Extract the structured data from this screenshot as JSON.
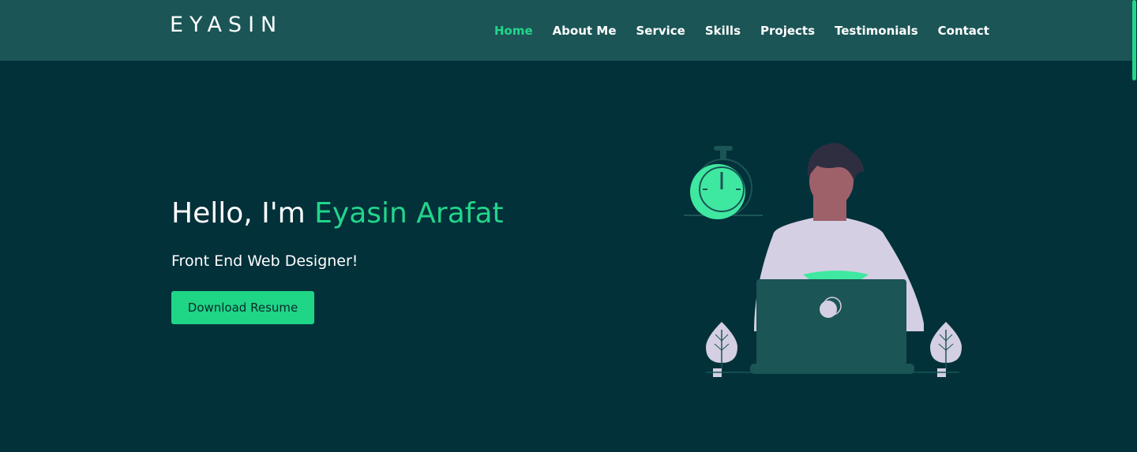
{
  "header": {
    "logo": "EYASIN",
    "nav": [
      {
        "label": "Home",
        "active": true
      },
      {
        "label": "About Me",
        "active": false
      },
      {
        "label": "Service",
        "active": false
      },
      {
        "label": "Skills",
        "active": false
      },
      {
        "label": "Projects",
        "active": false
      },
      {
        "label": "Testimonials",
        "active": false
      },
      {
        "label": "Contact",
        "active": false
      }
    ]
  },
  "hero": {
    "greeting": "Hello, I'm ",
    "name": "Eyasin Arafat",
    "subtitle": "Front End Web Designer!",
    "button_label": "Download Resume"
  },
  "colors": {
    "background": "#02313a",
    "header": "#1b5556",
    "accent": "#23d58b"
  }
}
